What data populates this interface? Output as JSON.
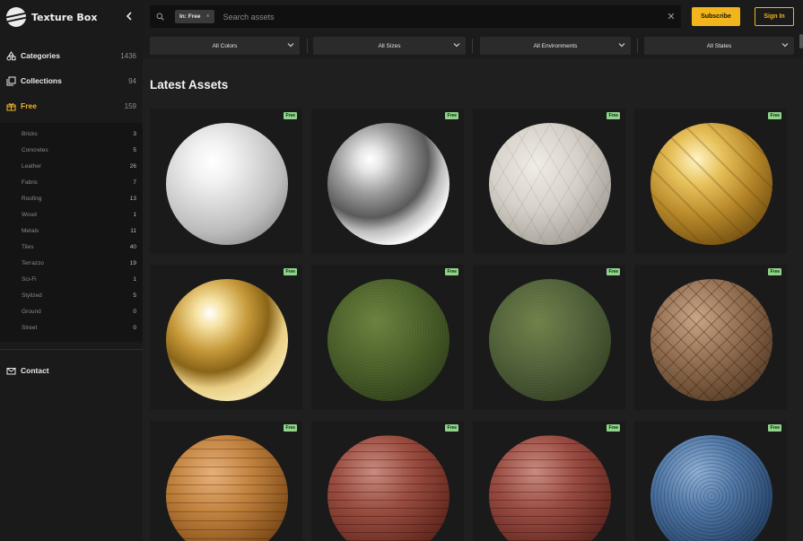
{
  "brand": {
    "name": "Texture Box",
    "collapse_icon": "chevron-left"
  },
  "nav": {
    "categories": {
      "label": "Categories",
      "count": "1436",
      "icon": "categories-icon"
    },
    "collections": {
      "label": "Collections",
      "count": "94",
      "icon": "collections-icon"
    },
    "free": {
      "label": "Free",
      "count": "159",
      "icon": "gift-icon"
    },
    "contact": {
      "label": "Contact",
      "icon": "mail-icon"
    }
  },
  "subcategories": [
    {
      "label": "Bricks",
      "count": "3"
    },
    {
      "label": "Concretes",
      "count": "5"
    },
    {
      "label": "Leather",
      "count": "26"
    },
    {
      "label": "Fabric",
      "count": "7"
    },
    {
      "label": "Roofing",
      "count": "13"
    },
    {
      "label": "Wood",
      "count": "1"
    },
    {
      "label": "Metals",
      "count": "11"
    },
    {
      "label": "Tiles",
      "count": "40"
    },
    {
      "label": "Terrazzo",
      "count": "19"
    },
    {
      "label": "Sci-Fi",
      "count": "1"
    },
    {
      "label": "Stylized",
      "count": "5"
    },
    {
      "label": "Ground",
      "count": "0"
    },
    {
      "label": "Street",
      "count": "0"
    }
  ],
  "search": {
    "chip_label": "In: Free",
    "placeholder": "Search assets",
    "value": ""
  },
  "header": {
    "subscribe_label": "Subscribe",
    "signin_label": "Sign In"
  },
  "filters": [
    {
      "label": "All Colors"
    },
    {
      "label": "All Sizes"
    },
    {
      "label": "All Environments"
    },
    {
      "label": "All States"
    }
  ],
  "main": {
    "title": "Latest Assets",
    "badge_label": "Free"
  },
  "assets": [
    {
      "material": "brushed-silver"
    },
    {
      "material": "chrome"
    },
    {
      "material": "tile-hexagon"
    },
    {
      "material": "gold-ornamental"
    },
    {
      "material": "gold"
    },
    {
      "material": "grass-moss"
    },
    {
      "material": "moss"
    },
    {
      "material": "wood-herringbone"
    },
    {
      "material": "wood-planks"
    },
    {
      "material": "red-brick"
    },
    {
      "material": "red-brick-2"
    },
    {
      "material": "blue-fabric"
    }
  ],
  "colors": {
    "accent": "#f2b51c",
    "badge": "#8fd48a",
    "background": "#1f1f1f",
    "sidebar": "#1a1a1a"
  }
}
